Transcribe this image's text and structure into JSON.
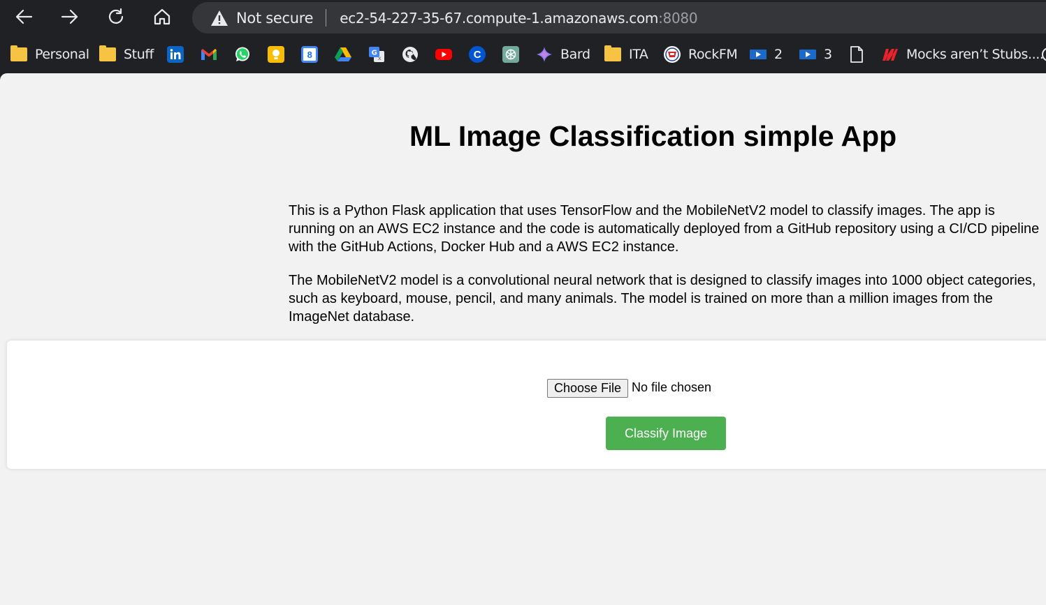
{
  "browser": {
    "security_label": "Not secure",
    "url_host": "ec2-54-227-35-67.compute-1.amazonaws.com",
    "url_port": ":8080",
    "bookmarks": [
      {
        "label": "Personal",
        "icon": "folder-icon"
      },
      {
        "label": "Stuff",
        "icon": "folder-icon"
      },
      {
        "label": "",
        "icon": "linkedin-icon"
      },
      {
        "label": "",
        "icon": "gmail-icon"
      },
      {
        "label": "",
        "icon": "whatsapp-icon"
      },
      {
        "label": "",
        "icon": "keep-icon"
      },
      {
        "label": "",
        "icon": "calendar-icon"
      },
      {
        "label": "",
        "icon": "drive-icon"
      },
      {
        "label": "",
        "icon": "translate-icon"
      },
      {
        "label": "",
        "icon": "github-icon"
      },
      {
        "label": "",
        "icon": "youtube-icon"
      },
      {
        "label": "",
        "icon": "coursera-icon"
      },
      {
        "label": "",
        "icon": "chatgpt-icon"
      },
      {
        "label": "Bard",
        "icon": "bard-icon"
      },
      {
        "label": "ITA",
        "icon": "folder-icon"
      },
      {
        "label": "RockFM",
        "icon": "rockfm-icon"
      },
      {
        "label": "2",
        "icon": "play-icon"
      },
      {
        "label": "3",
        "icon": "play-icon"
      },
      {
        "label": "",
        "icon": "page-icon"
      },
      {
        "label": "Mocks aren’t Stubs....",
        "icon": "martinfowler-icon"
      }
    ],
    "calendar_day": "8",
    "coursera_letter": "C"
  },
  "page": {
    "title": "ML Image Classification simple App",
    "paragraph1": "This is a Python Flask application that uses TensorFlow and the MobileNetV2 model to classify images. The app is running on an AWS EC2 instance and the code is automatically deployed from a GitHub repository using a CI/CD pipeline with the GitHub Actions, Docker Hub and a AWS EC2 instance.",
    "paragraph2": "The MobileNetV2 model is a convolutional neural network that is designed to classify images into 1000 object categories, such as keyboard, mouse, pencil, and many animals. The model is trained on more than a million images from the ImageNet database.",
    "file_button": "Choose File",
    "file_status": "No file chosen",
    "submit_label": "Classify Image"
  },
  "colors": {
    "submit_bg": "#4caf50",
    "page_bg": "#f2f2f2",
    "chrome_bg": "#202124"
  }
}
